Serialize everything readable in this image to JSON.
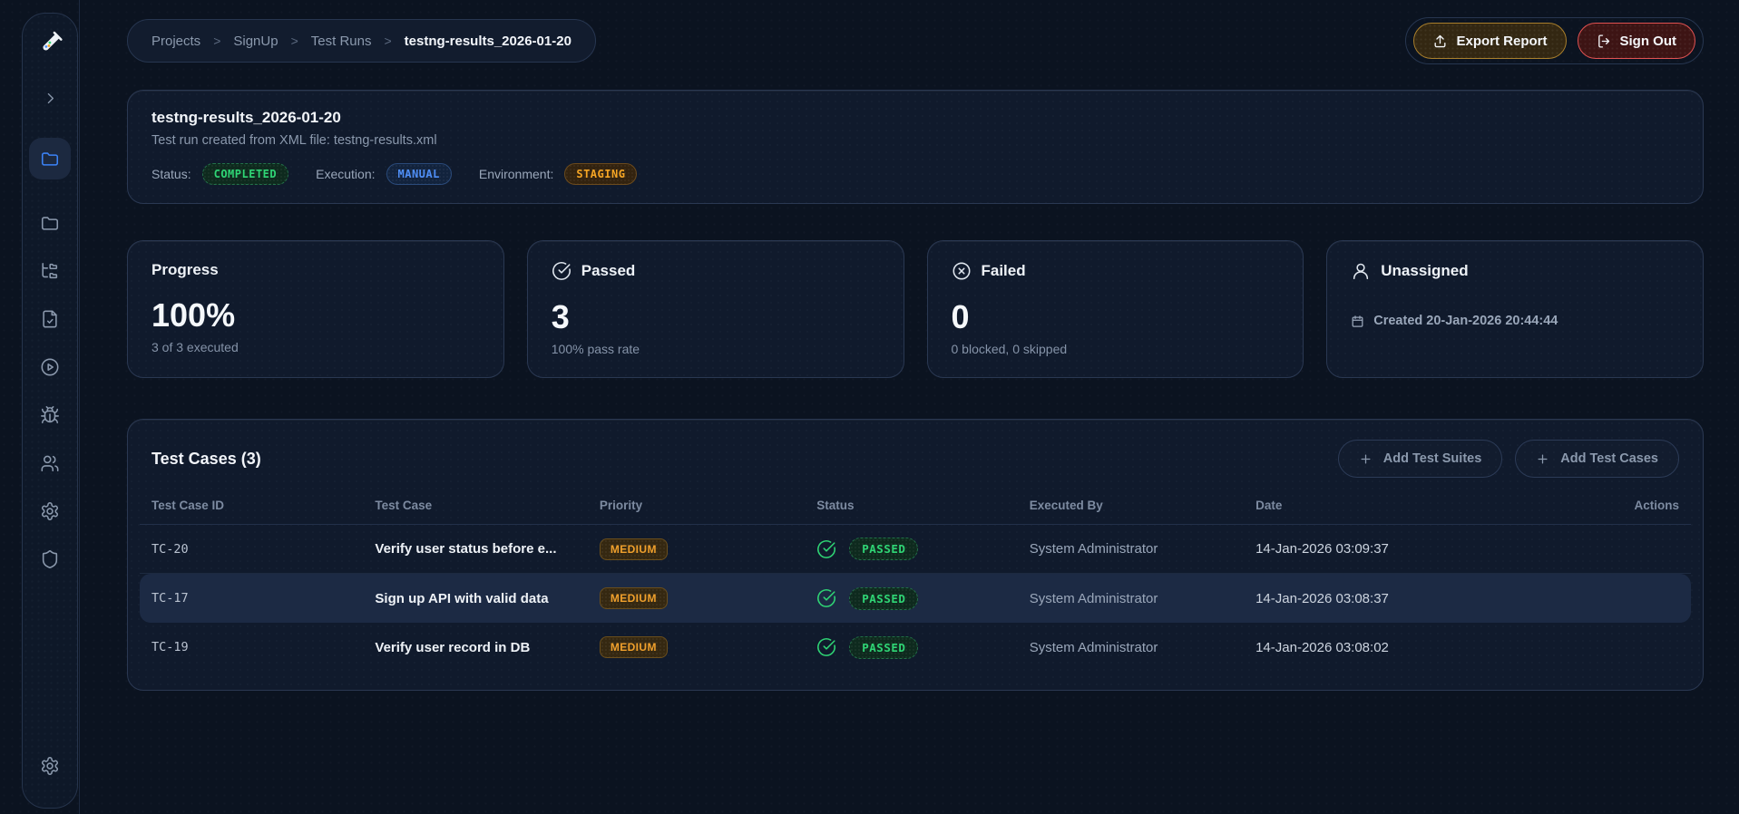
{
  "colors": {
    "background": "#0b1320",
    "card": "#101a2c",
    "accent_green": "#2fd575",
    "accent_blue": "#4f8ff7",
    "accent_amber": "#f5a524",
    "accent_red": "#e05252",
    "active_icon_blue": "#3b82f6"
  },
  "sidebar": {
    "icons": [
      "test-tube-logo",
      "chevron-right",
      "folder-active",
      "folder",
      "folder-tree",
      "file-check",
      "play-circle",
      "bug",
      "users",
      "gear",
      "shield",
      "gear-bottom"
    ]
  },
  "breadcrumb": {
    "items": [
      "Projects",
      "SignUp",
      "Test Runs"
    ],
    "separator": ">",
    "current": "testng-results_2026-01-20"
  },
  "header_actions": {
    "export_label": "Export Report",
    "signout_label": "Sign Out"
  },
  "run": {
    "title": "testng-results_2026-01-20",
    "subtitle": "Test run created from XML file: testng-results.xml",
    "status_label": "Status:",
    "status_value": "COMPLETED",
    "execution_label": "Execution:",
    "execution_value": "MANUAL",
    "environment_label": "Environment:",
    "environment_value": "STAGING"
  },
  "stats": [
    {
      "title": "Progress",
      "value": "100%",
      "subtext": "3 of 3 executed"
    },
    {
      "title": "Passed",
      "value": "3",
      "subtext": "100% pass rate",
      "icon": "check-circle"
    },
    {
      "title": "Failed",
      "value": "0",
      "subtext": "0 blocked, 0 skipped",
      "icon": "x-circle"
    },
    {
      "title": "Unassigned",
      "created": "Created 20-Jan-2026 20:44:44",
      "icon": "user"
    }
  ],
  "test_cases": {
    "title": "Test Cases (3)",
    "add_suites_label": "Add Test Suites",
    "add_cases_label": "Add Test Cases",
    "columns": [
      "Test Case ID",
      "Test Case",
      "Priority",
      "Status",
      "Executed By",
      "Date",
      "Actions"
    ],
    "rows": [
      {
        "id": "TC-20",
        "name": "Verify user status before e...",
        "priority": "MEDIUM",
        "status": "PASSED",
        "executed_by": "System Administrator",
        "date": "14-Jan-2026 03:09:37"
      },
      {
        "id": "TC-17",
        "name": "Sign up API with valid data",
        "priority": "MEDIUM",
        "status": "PASSED",
        "executed_by": "System Administrator",
        "date": "14-Jan-2026 03:08:37"
      },
      {
        "id": "TC-19",
        "name": "Verify user record in DB",
        "priority": "MEDIUM",
        "status": "PASSED",
        "executed_by": "System Administrator",
        "date": "14-Jan-2026 03:08:02"
      }
    ]
  }
}
